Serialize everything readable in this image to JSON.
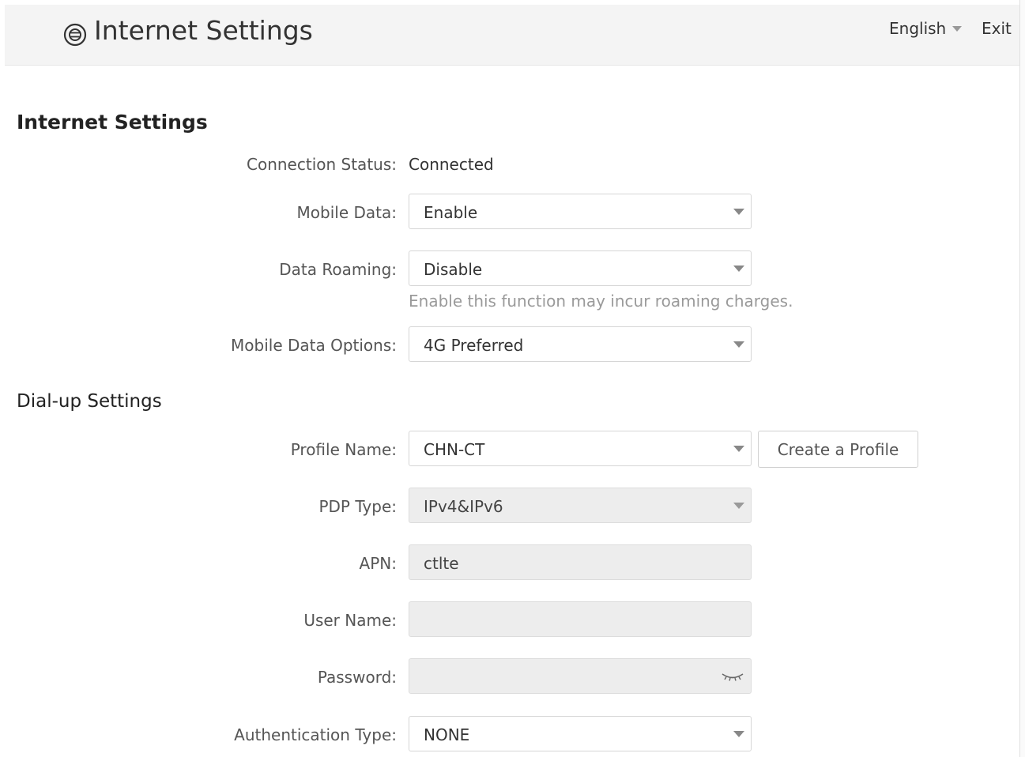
{
  "header": {
    "title": "Internet Settings",
    "icon": "internet-globe-icon",
    "language": "English",
    "exit_label": "Exit"
  },
  "section": {
    "title": "Internet Settings"
  },
  "fields": {
    "connection_status": {
      "label": "Connection Status:",
      "value": "Connected"
    },
    "mobile_data": {
      "label": "Mobile Data:",
      "value": "Enable"
    },
    "data_roaming": {
      "label": "Data Roaming:",
      "value": "Disable",
      "hint": "Enable this function may incur roaming charges."
    },
    "mobile_data_options": {
      "label": "Mobile Data Options:",
      "value": "4G Preferred"
    }
  },
  "dialup": {
    "title": "Dial-up Settings",
    "profile_name": {
      "label": "Profile Name:",
      "value": "CHN-CT",
      "create_button": "Create a Profile"
    },
    "pdp_type": {
      "label": "PDP Type:",
      "value": "IPv4&IPv6"
    },
    "apn": {
      "label": "APN:",
      "value": "ctlte"
    },
    "user_name": {
      "label": "User Name:",
      "value": ""
    },
    "password": {
      "label": "Password:",
      "value": "",
      "toggle_icon": "eye-closed-icon"
    },
    "auth_type": {
      "label": "Authentication Type:",
      "value": "NONE"
    }
  },
  "colors": {
    "header_bg": "#f4f4f4",
    "text": "#333333",
    "label": "#555555",
    "hint": "#9a9a9a",
    "disabled_field": "#ededed",
    "border": "#d6d6d6"
  }
}
